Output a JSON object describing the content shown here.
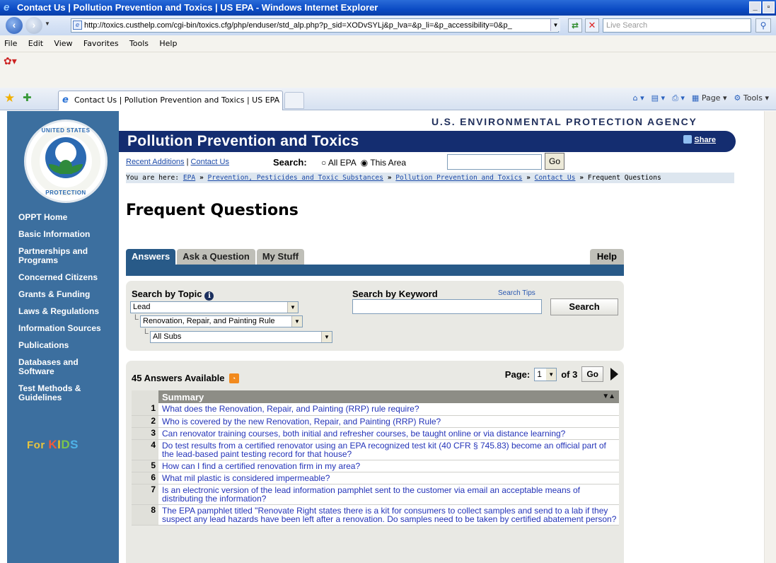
{
  "window": {
    "title": "Contact Us | Pollution Prevention and Toxics | US EPA - Windows Internet Explorer",
    "url": "http://toxics.custhelp.com/cgi-bin/toxics.cfg/php/enduser/std_alp.php?p_sid=XODvSYLj&p_lva=&p_li=&p_accessibility=0&p_",
    "live_search_placeholder": "Live Search",
    "menu": [
      "File",
      "Edit",
      "View",
      "Favorites",
      "Tools",
      "Help"
    ],
    "tab_title": "Contact Us | Pollution Prevention and Toxics | US EPA",
    "cmd_page": "Page",
    "cmd_tools": "Tools"
  },
  "header": {
    "agency": "U.S. ENVIRONMENTAL PROTECTION AGENCY",
    "banner_title": "Pollution Prevention and Toxics",
    "share": "Share",
    "recent_additions": "Recent Additions",
    "separator": "|",
    "contact_us": "Contact Us",
    "search_label": "Search:",
    "scope_all": "All EPA",
    "scope_area": "This Area",
    "go": "Go",
    "breadcrumb_prefix": "You are here:",
    "breadcrumb": [
      "EPA",
      "Prevention, Pesticides and Toxic Substances",
      "Pollution Prevention and Toxics",
      "Contact Us"
    ],
    "breadcrumb_current": "Frequent Questions",
    "breadcrumb_sep": "»"
  },
  "seal": {
    "top_text": "UNITED STATES",
    "bottom_text": "PROTECTION",
    "left_text": "ENVIRONMENTAL",
    "right_text": "AGENCY"
  },
  "sidebar": {
    "items": [
      "OPPT Home",
      "Basic Information",
      "Partnerships and Programs",
      "Concerned Citizens",
      "Grants & Funding",
      "Laws & Regulations",
      "Information Sources",
      "Publications",
      "Databases and Software",
      "Test Methods & Guidelines"
    ],
    "kids_for": "For",
    "kids_k": "K",
    "kids_i": "I",
    "kids_d": "D",
    "kids_s": "S"
  },
  "page_title": "Frequent Questions",
  "tabs": {
    "answers": "Answers",
    "ask": "Ask a Question",
    "mystuff": "My Stuff",
    "help": "Help"
  },
  "search_panel": {
    "topic_label": "Search by Topic",
    "keyword_label": "Search by Keyword",
    "search_tips": "Search Tips",
    "topic_value": "Lead",
    "subtopic_value": "Renovation, Repair, and Painting Rule",
    "sub_value": "All Subs",
    "search_button": "Search",
    "tree_mark": "L",
    "info_glyph": "i"
  },
  "results": {
    "count_text": "45 Answers Available",
    "page_label": "Page:",
    "page_value": "1",
    "of_text": "of 3",
    "go": "Go",
    "summary_header": "Summary",
    "rows": [
      {
        "n": "1",
        "q": "What does the Renovation, Repair, and Painting (RRP) rule require?"
      },
      {
        "n": "2",
        "q": "Who is covered by the new Renovation, Repair, and Painting (RRP) Rule?"
      },
      {
        "n": "3",
        "q": "Can renovator training courses, both initial and refresher courses, be taught online or via distance learning?"
      },
      {
        "n": "4",
        "q": "Do test results from a certified renovator using an EPA recognized test kit (40 CFR § 745.83) become an official part of the lead-based paint testing record for that house?"
      },
      {
        "n": "5",
        "q": "How can I find a certified renovation firm in my area?"
      },
      {
        "n": "6",
        "q": "What mil plastic is considered impermeable?"
      },
      {
        "n": "7",
        "q": "Is an electronic version of the lead information pamphlet sent to the customer via email an acceptable means of distributing the information?"
      },
      {
        "n": "8",
        "q": "The EPA pamphlet titled \"Renovate Right states there is a kit for consumers to collect samples and send to a lab if they suspect any lead hazards have been left after a renovation. Do samples need to be taken by certified abatement person?"
      }
    ]
  }
}
